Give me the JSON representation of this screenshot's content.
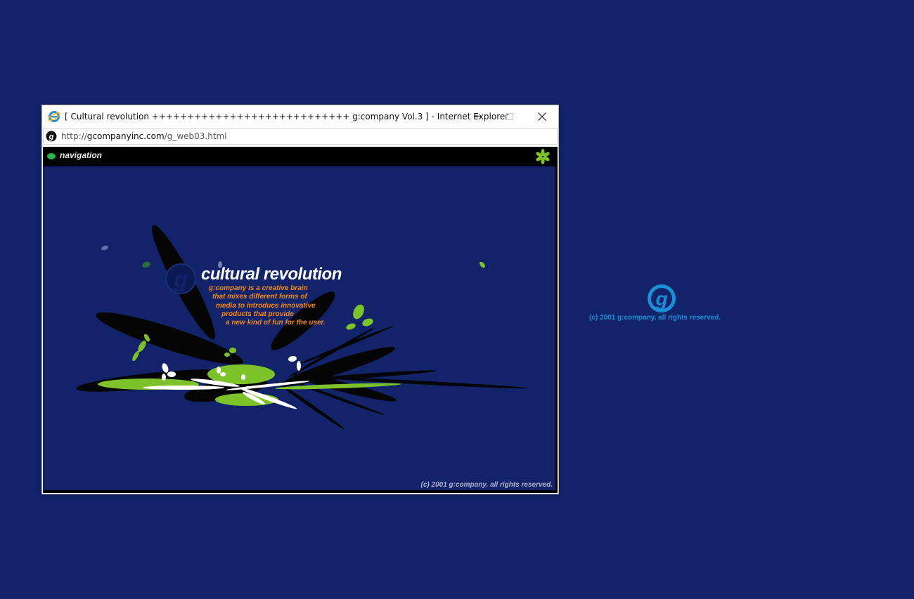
{
  "window": {
    "title": "[ Cultural revolution ++++++++++++++++++++++++++++ g:company Vol.3 ] - Internet Explorer",
    "minimize_icon": "minimize-icon",
    "maximize_icon": "maximize-icon",
    "close_icon": "close-icon"
  },
  "address": {
    "prefix": "http://",
    "host": "gcompanyinc.com",
    "path": "/g_web03.html"
  },
  "navbar": {
    "label": "navigation",
    "accent": "#27b24a"
  },
  "stage": {
    "headline": "cultural revolution",
    "tagline": [
      "g:company is a creative brain",
      "that mixes different forms of",
      "media to introduce innovative",
      "products that provide",
      "a new kind of fun for the user."
    ],
    "copyright": "(c) 2001 g:company. all rights reserved.",
    "colors": {
      "background": "#13236a",
      "green": "#7dc22a",
      "orange": "#f08a1a",
      "petal_black": "#050505"
    }
  },
  "desktop": {
    "logo_icon": "g-logo-icon",
    "copyright": "(c) 2001 g:company. all rights reserved.",
    "logo_color": "#1a8fd6"
  }
}
